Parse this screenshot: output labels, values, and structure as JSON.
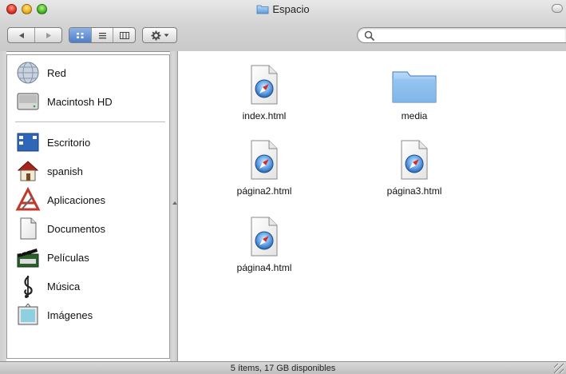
{
  "window": {
    "title": "Espacio"
  },
  "toolbar": {
    "nav": {
      "back_icon": "back-arrow-icon",
      "forward_icon": "forward-arrow-icon"
    },
    "views": {
      "icon_view": "icon-view-icon",
      "list_view": "list-view-icon",
      "column_view": "column-view-icon",
      "active": "icon"
    },
    "action_icon": "gear-icon",
    "search": {
      "value": "",
      "placeholder": ""
    }
  },
  "sidebar": {
    "devices": [
      {
        "label": "Red",
        "icon": "network-globe-icon"
      },
      {
        "label": "Macintosh HD",
        "icon": "hard-drive-icon"
      }
    ],
    "places": [
      {
        "label": "Escritorio",
        "icon": "desktop-icon"
      },
      {
        "label": "spanish",
        "icon": "home-icon"
      },
      {
        "label": "Aplicaciones",
        "icon": "applications-icon"
      },
      {
        "label": "Documentos",
        "icon": "documents-icon"
      },
      {
        "label": "Películas",
        "icon": "movies-clapper-icon"
      },
      {
        "label": "Música",
        "icon": "music-clef-icon"
      },
      {
        "label": "Imágenes",
        "icon": "pictures-icon"
      }
    ]
  },
  "files": [
    {
      "name": "index.html",
      "type": "html"
    },
    {
      "name": "media",
      "type": "folder"
    },
    {
      "name": "página2.html",
      "type": "html"
    },
    {
      "name": "página3.html",
      "type": "html"
    },
    {
      "name": "página4.html",
      "type": "html"
    }
  ],
  "status": {
    "text": "5 ítems, 17 GB disponibles"
  },
  "colors": {
    "accent": "#4d7dc9",
    "folder": "#7fb3e8",
    "close": "#e0392b",
    "minimize": "#f0b41f",
    "zoom": "#4bbd2c"
  }
}
